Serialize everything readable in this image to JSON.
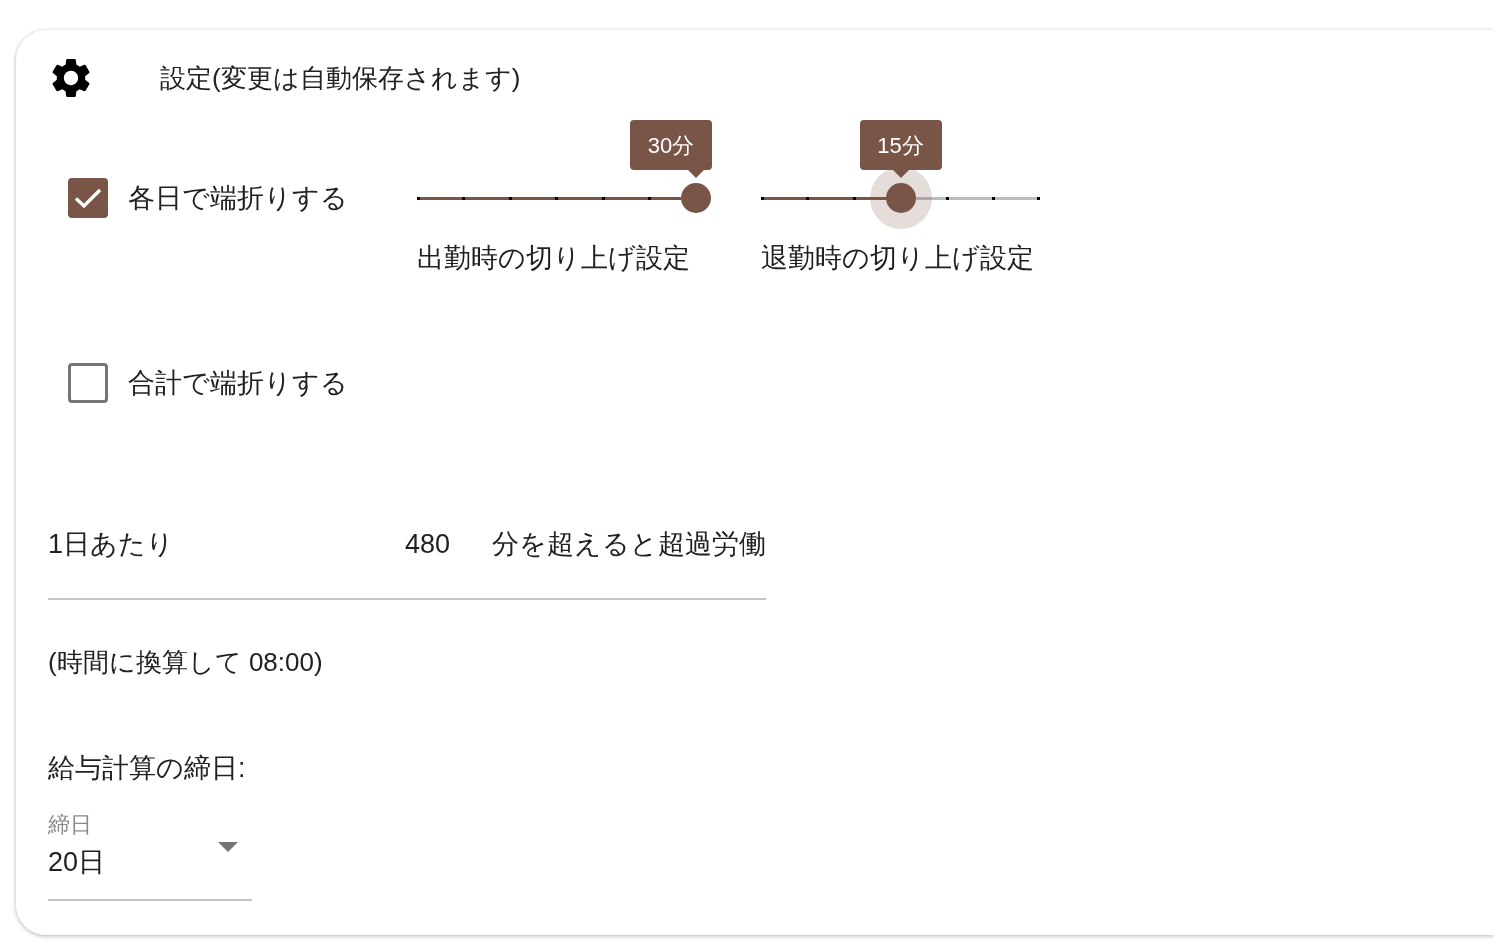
{
  "header": {
    "title": "設定(変更は自動保存されます)"
  },
  "rounding_options": [
    {
      "label": "各日で端折りする",
      "checked": true,
      "sliders": [
        {
          "label": "出勤時の切り上げ設定",
          "value_label": "30分",
          "level": 1,
          "focused": false
        },
        {
          "label": "退勤時の切り上げ設定",
          "value_label": "15分",
          "level": 0.5,
          "focused": true
        }
      ]
    },
    {
      "label": "合計で端折りする",
      "checked": false
    }
  ],
  "overtime_threshold": {
    "prefix": "1日あたり",
    "value": "480",
    "suffix": "分を超えると超過労働"
  },
  "overtime_in_hours": "(時間に換算して 08:00)",
  "closing_day": {
    "heading": "給与計算の締日:",
    "select": {
      "label": "締日",
      "value": "20日"
    }
  }
}
